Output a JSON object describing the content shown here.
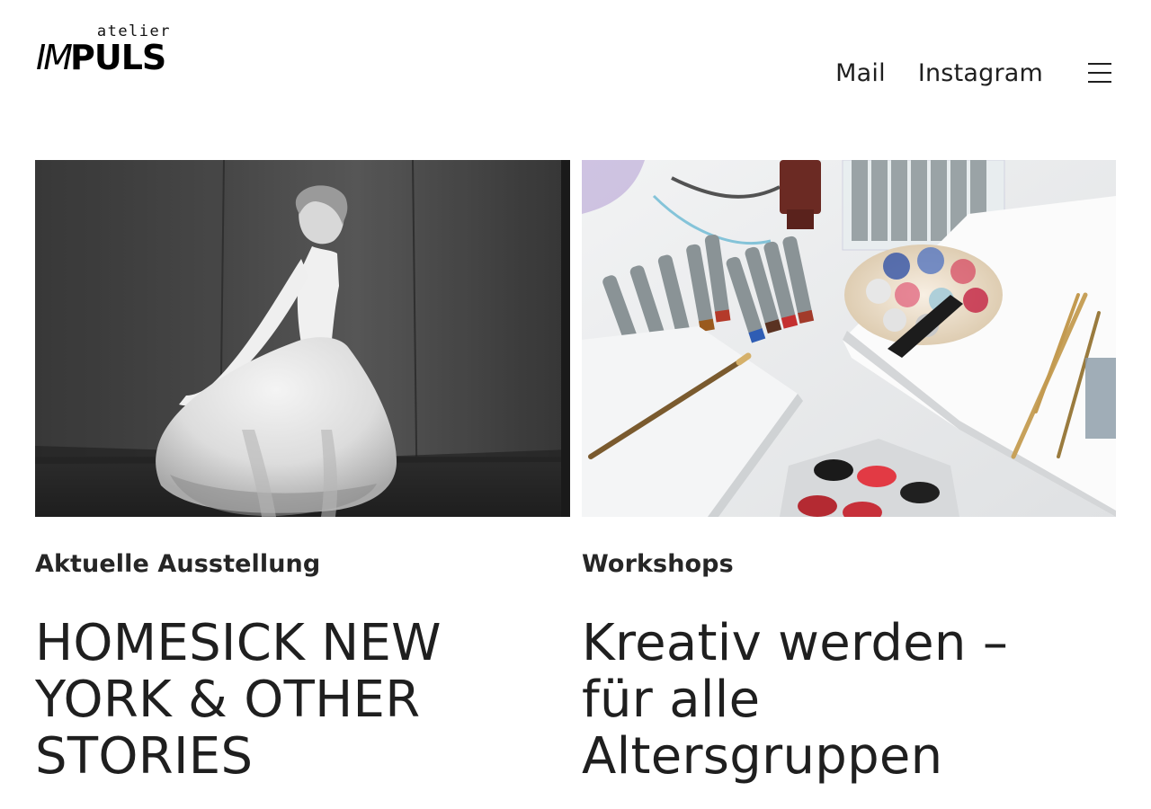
{
  "brand": {
    "small": "atelier",
    "big_prefix": "IM",
    "big_suffix": "PULS"
  },
  "nav": {
    "items": [
      {
        "label": "Mail"
      },
      {
        "label": "Instagram"
      }
    ],
    "menu_icon": "hamburger-menu-icon"
  },
  "cards": [
    {
      "kicker": "Aktuelle Ausstellung",
      "title": "HOMESICK NEW YORK & OTHER STORIES",
      "image": "black-and-white-photo-woman-twirling-dress"
    },
    {
      "kicker": "Workshops",
      "title": "Kreativ werden – für alle Altersgruppen",
      "image": "art-supplies-markers-palette-brushes"
    }
  ]
}
